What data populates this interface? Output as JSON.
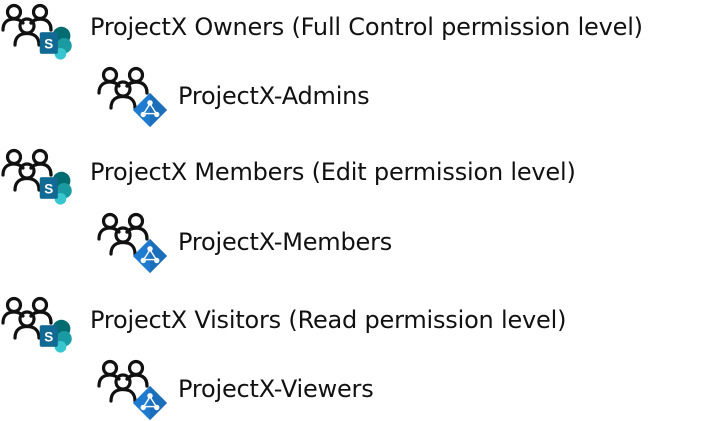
{
  "colors": {
    "sharepoint_dark": "#036c70",
    "sharepoint_mid": "#1a9ba1",
    "sharepoint_light": "#37c6d0",
    "sharepoint_blue": "#1f5fa8",
    "azure_blue": "#1f7bd0",
    "azure_dark": "#155fa0",
    "people_stroke": "#111111"
  },
  "groups": [
    {
      "label": "ProjectX Owners (Full Control permission level)",
      "icon": "sharepoint-group-icon",
      "child": {
        "label": "ProjectX-Admins",
        "icon": "azure-ad-group-icon"
      }
    },
    {
      "label": "ProjectX Members (Edit permission level)",
      "icon": "sharepoint-group-icon",
      "child": {
        "label": "ProjectX-Members",
        "icon": "azure-ad-group-icon"
      }
    },
    {
      "label": "ProjectX Visitors (Read permission level)",
      "icon": "sharepoint-group-icon",
      "child": {
        "label": "ProjectX-Viewers",
        "icon": "azure-ad-group-icon"
      }
    }
  ]
}
